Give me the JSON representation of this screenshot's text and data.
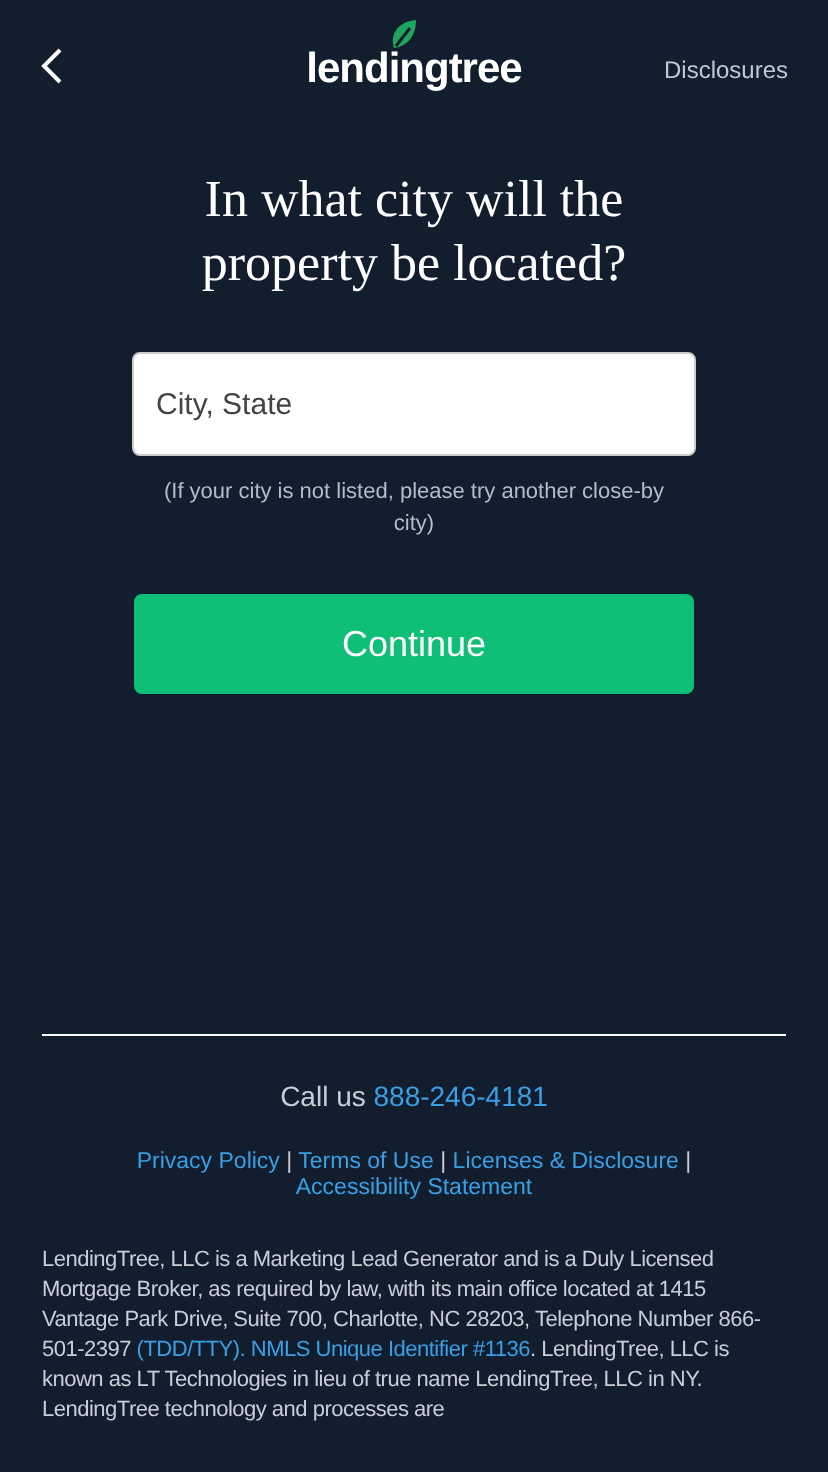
{
  "header": {
    "brand": "lendingtree",
    "disclosures": "Disclosures"
  },
  "question": "In what city will the property be located?",
  "city_field": {
    "placeholder": "City, State"
  },
  "hint": "(If your city is not listed, please try another close-by city)",
  "continue_button": "Continue",
  "footer": {
    "call_label": "Call us",
    "phone": "888-246-4181",
    "links": [
      {
        "kind": "link",
        "text": "Privacy Policy"
      },
      {
        "kind": "separator",
        "text": "|"
      },
      {
        "kind": "link",
        "text": "Terms of Use"
      },
      {
        "kind": "separator",
        "text": "|"
      },
      {
        "kind": "link",
        "text": "Licenses & Disclosure"
      },
      {
        "kind": "separator",
        "text": "|"
      },
      {
        "kind": "link",
        "text": "Accessibility Statement"
      }
    ],
    "disclaimer": [
      {
        "kind": "text",
        "text": "LendingTree, LLC is a Marketing Lead Generator and is a Duly Licensed Mortgage Broker, as required by law, with its main office located at 1415 Vantage Park Drive, Suite 700, Charlotte, NC 28203, Telephone Number 866-501-2397 "
      },
      {
        "kind": "link",
        "text": "(TDD/TTY). NMLS Unique Identifier #1136"
      },
      {
        "kind": "text",
        "text": ". LendingTree, LLC is known as LT Technologies in lieu of true name LendingTree, LLC in NY. LendingTree technology and processes are"
      }
    ]
  }
}
